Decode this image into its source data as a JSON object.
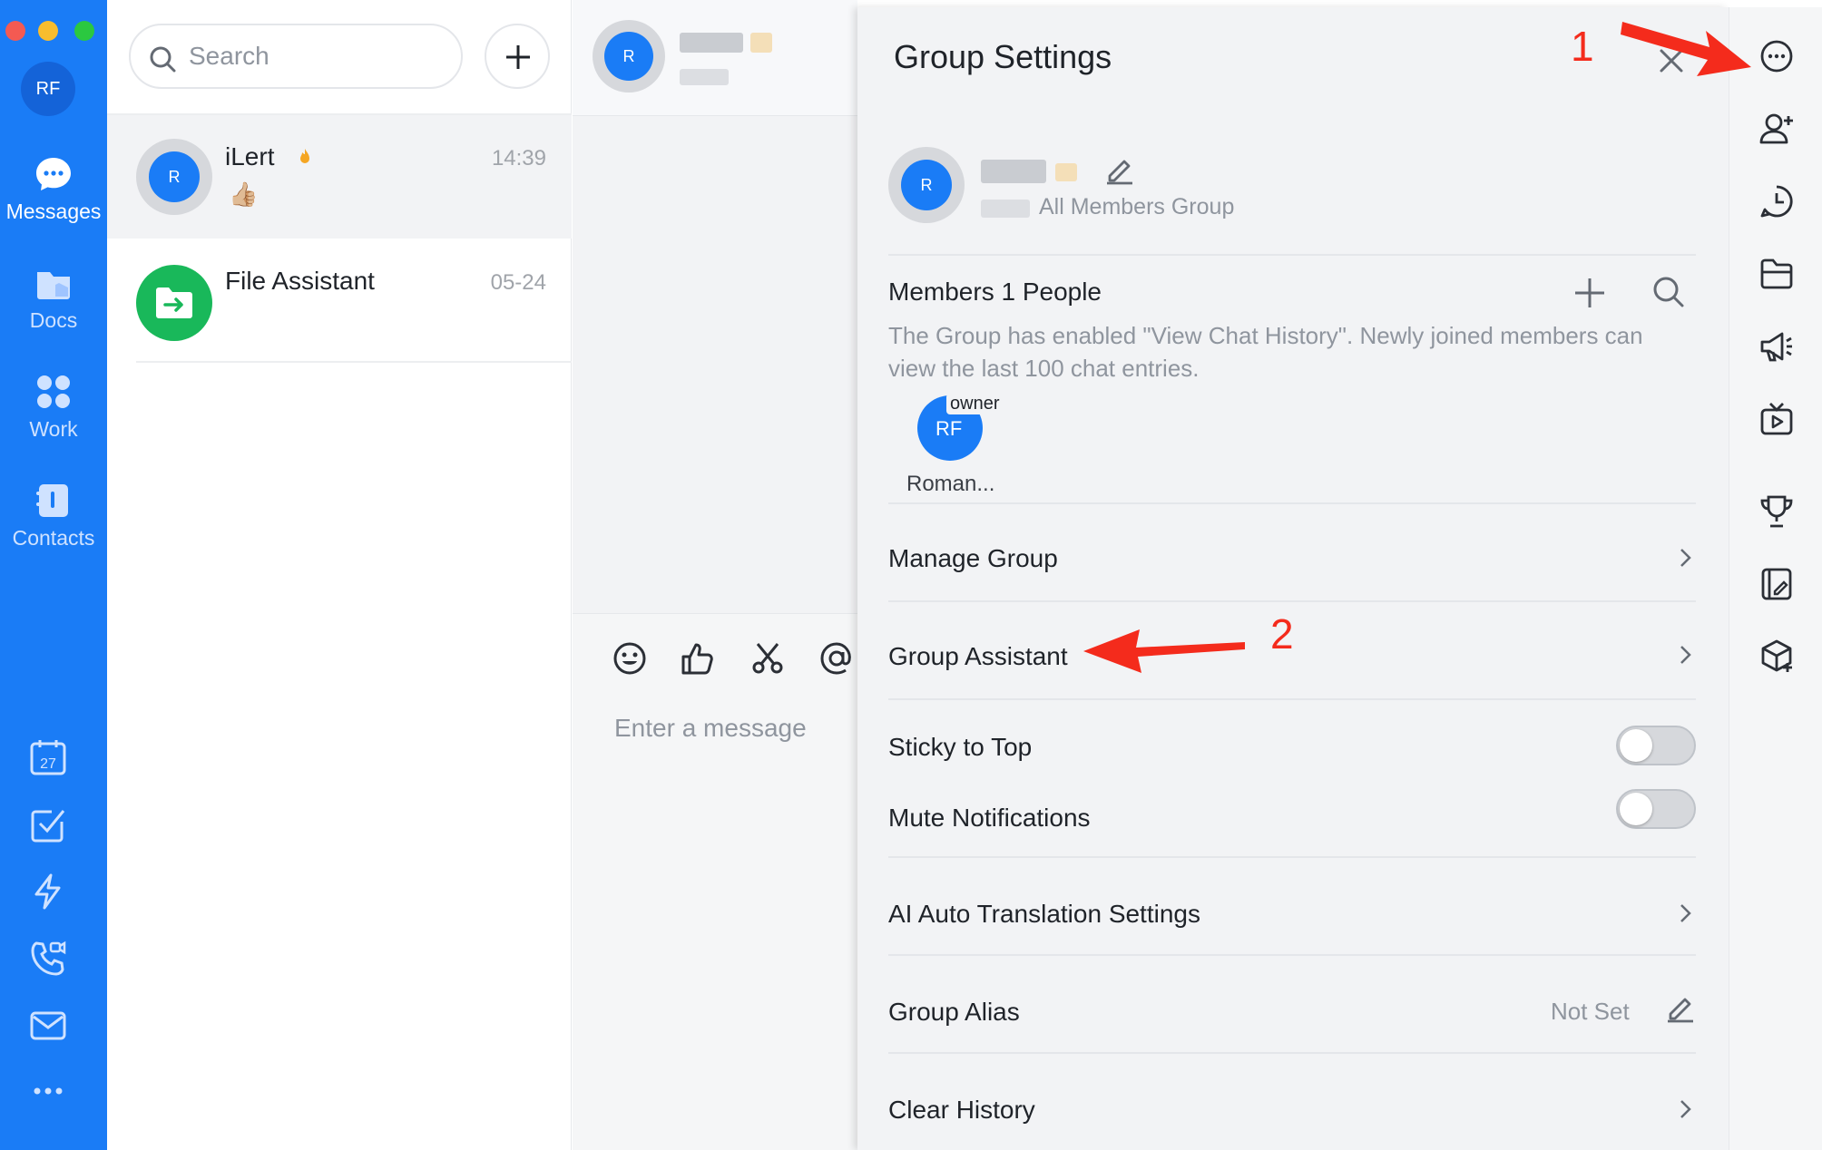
{
  "window": {
    "traffic_lights": [
      "#f45a52",
      "#f8bd2e",
      "#2bc840"
    ]
  },
  "rail": {
    "user_initials": "RF",
    "items": [
      {
        "label": "Messages",
        "icon": "chat-bubble-icon",
        "active": true
      },
      {
        "label": "Docs",
        "icon": "docs-icon",
        "active": false
      },
      {
        "label": "Work",
        "icon": "grid-icon",
        "active": false
      },
      {
        "label": "Contacts",
        "icon": "contacts-icon",
        "active": false
      }
    ],
    "bottom_icons": [
      "calendar-icon",
      "task-check-icon",
      "lightning-icon",
      "phone-video-icon",
      "mail-icon",
      "more-icon"
    ],
    "calendar_day": "27",
    "accent": "#1a7cf6"
  },
  "chat_list": {
    "search_placeholder": "Search",
    "items": [
      {
        "name": "iLert",
        "time": "14:39",
        "avatar_text": "R",
        "preview_emoji": "👍🏼"
      },
      {
        "name": "File Assistant",
        "time": "05-24"
      }
    ]
  },
  "chat": {
    "header_avatar": "R",
    "composer_placeholder": "Enter a message",
    "toolbar_icons": [
      "emoji-icon",
      "thumbs-up-icon",
      "scissors-icon",
      "at-icon"
    ]
  },
  "group_settings": {
    "title": "Group Settings",
    "group_avatar": "R",
    "group_type": "All Members Group",
    "members_label": "Members 1 People",
    "history_notice": "The Group has enabled \"View Chat History\". Newly joined members can view the last 100 chat entries.",
    "member": {
      "initials": "RF",
      "role": "owner",
      "name": "Roman..."
    },
    "rows": {
      "manage_group": "Manage Group",
      "group_assistant": "Group Assistant",
      "sticky_to_top": "Sticky to Top",
      "mute_notifications": "Mute Notifications",
      "ai_translation": "AI Auto Translation Settings",
      "group_alias": "Group Alias",
      "group_alias_value": "Not Set",
      "clear_history": "Clear History"
    },
    "toggles": {
      "sticky_to_top": false,
      "mute_notifications": false
    }
  },
  "right_toolbar": {
    "icons": [
      "more-options-icon",
      "add-member-icon",
      "history-clock-icon",
      "folder-icon",
      "announcement-icon",
      "live-tv-icon",
      "trophy-icon",
      "notes-icon",
      "add-app-icon"
    ]
  },
  "annotations": {
    "label_1": "1",
    "label_2": "2",
    "color": "#f42b1c"
  }
}
